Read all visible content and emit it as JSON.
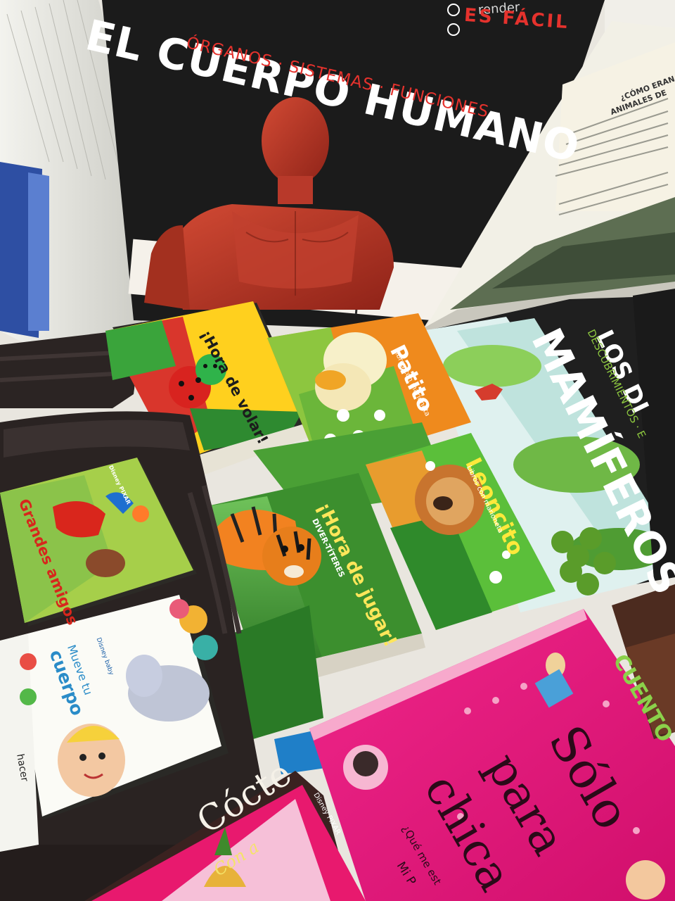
{
  "cuerpo_humano": {
    "series_fragment": "render",
    "series_name": "ES FÁCIL",
    "title": "EL CUERPO HUMANO",
    "subtitle": "ÓRGANOS · SISTEMAS · FUNCIONES"
  },
  "dino_page": {
    "heading_1": "¿CÓMO ERAN",
    "heading_2": "ANIMALES DE"
  },
  "mamiferos": {
    "top_text": "LOS DI",
    "subtitle": "DESCUBRIMIENTOS · E",
    "title": "MAMÍFEROS"
  },
  "hora_volar": {
    "title": "¡Hora de volar!"
  },
  "patito": {
    "title": "Patito",
    "tagline": "Libros con marioneta"
  },
  "leoncito": {
    "title": "Leoncito",
    "tagline": "Libros con marioneta"
  },
  "hora_jugar": {
    "title": "¡Hora de jugar!",
    "tagline": "DIVER-TÍTERES"
  },
  "grandes_amigos": {
    "title": "Grandes amigos",
    "brand": "Disney PIXAR"
  },
  "mueve_cuerpo": {
    "title_1": "Mueve tu",
    "title_2": "cuerpo",
    "brand": "Disney baby",
    "spine_fragment": "hacer"
  },
  "solo_chicas": {
    "title_1": "Sólo",
    "title_2": "para",
    "title_3": "chica",
    "question": "¿Qué me est",
    "bottom_fragment": "Mi P"
  },
  "cocteles": {
    "title": "Cócte",
    "script": "Con a",
    "brand": "Disney PIXAR"
  },
  "cuentos": {
    "title": "CUENTO"
  },
  "colors": {
    "background": "#e9e6df",
    "black_book": "#1a1a1a",
    "red_accent": "#e5322d",
    "pink_book": "#e6157a",
    "orange_book": "#ef8a1d",
    "green_jungle": "#3f8d2e",
    "leoncito_green": "#5bbf3a"
  }
}
